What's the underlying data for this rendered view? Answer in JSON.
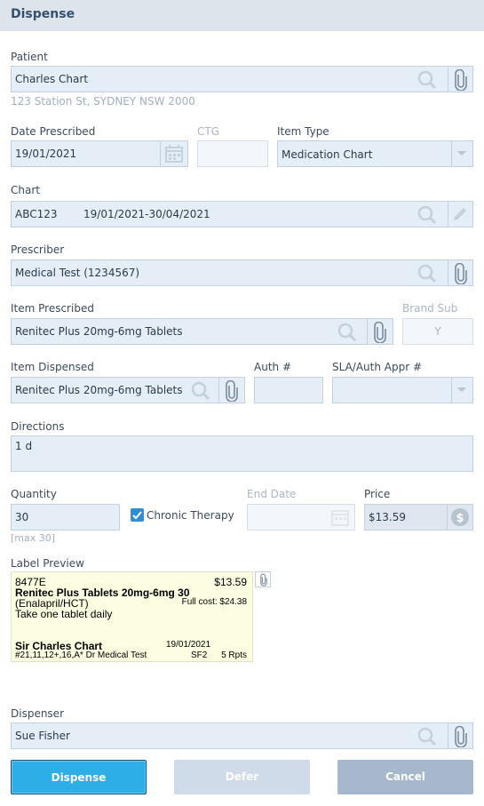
{
  "header": {
    "title": "Dispense"
  },
  "patient": {
    "label": "Patient",
    "value": "Charles Chart",
    "address": "123 Station St, SYDNEY NSW 2000"
  },
  "date_prescribed": {
    "label": "Date Prescribed",
    "value": "19/01/2021"
  },
  "ctg": {
    "label": "CTG",
    "value": ""
  },
  "item_type": {
    "label": "Item Type",
    "value": "Medication Chart"
  },
  "chart": {
    "label": "Chart",
    "code": "ABC123",
    "range": "19/01/2021-30/04/2021"
  },
  "prescriber": {
    "label": "Prescriber",
    "value": "Medical Test (1234567)"
  },
  "item_prescribed": {
    "label": "Item Prescribed",
    "value": "Renitec Plus 20mg-6mg Tablets"
  },
  "brand_sub": {
    "label": "Brand Sub",
    "value": "Y"
  },
  "item_dispensed": {
    "label": "Item Dispensed",
    "value": "Renitec Plus 20mg-6mg Tablets"
  },
  "auth_no": {
    "label": "Auth #",
    "value": ""
  },
  "sla_auth": {
    "label": "SLA/Auth Appr #",
    "value": ""
  },
  "directions": {
    "label": "Directions",
    "value": "1 d"
  },
  "quantity": {
    "label": "Quantity",
    "value": "30",
    "hint": "[max 30]"
  },
  "chronic_therapy": {
    "label": "Chronic Therapy",
    "checked": true
  },
  "end_date": {
    "label": "End Date",
    "value": ""
  },
  "price": {
    "label": "Price",
    "value": "$13.59"
  },
  "label_preview": {
    "label": "Label Preview",
    "code": "8477E",
    "price": "$13.59",
    "drug": "Renitec Plus Tablets 20mg-6mg 30",
    "generic": "(Enalapril/HCT)",
    "full_cost": "Full cost: $24.38",
    "instructions": "Take one tablet daily",
    "patient_name": "Sir Charles Chart",
    "date": "19/01/2021",
    "ref": "#21,11,12+,16,A* Dr Medical Test",
    "sf": "SF2",
    "repeats": "5 Rpts"
  },
  "dispenser": {
    "label": "Dispenser",
    "value": "Sue Fisher"
  },
  "buttons": {
    "dispense": "Dispense",
    "defer": "Defer",
    "cancel": "Cancel"
  },
  "colors": {
    "accent": "#2eaee6",
    "field_bg": "#e5edf7",
    "header_bg": "#dde4ec",
    "label_bg": "#fdfde1"
  },
  "icons": [
    "search-icon",
    "paperclip-icon",
    "calendar-icon",
    "chevron-down-icon",
    "pencil-icon",
    "dollar-icon",
    "check-icon"
  ]
}
